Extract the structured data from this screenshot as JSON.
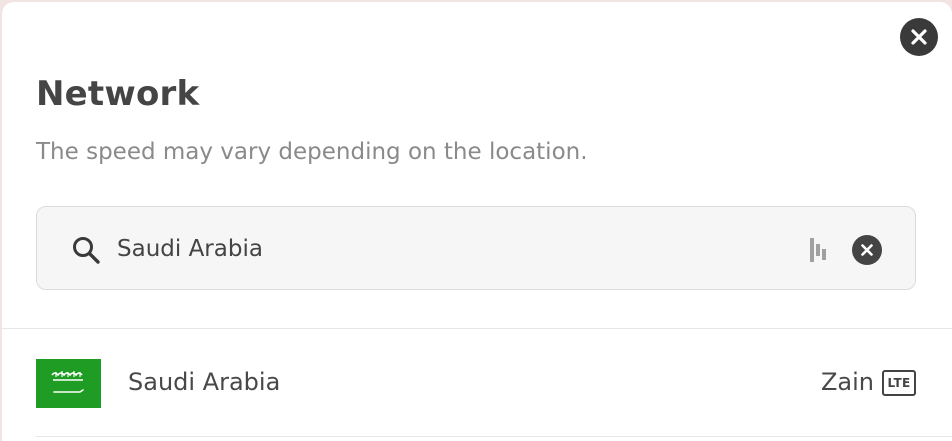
{
  "dialog": {
    "title": "Network",
    "subtitle": "The speed may vary depending on the location.",
    "close_icon": "close-icon"
  },
  "search": {
    "value": "Saudi Arabia",
    "placeholder": "",
    "search_icon": "search-icon",
    "extension_icon": "password-manager-icon",
    "clear_icon": "clear-icon"
  },
  "results": [
    {
      "country": "Saudi Arabia",
      "flag_icon": "saudi-arabia-flag-icon",
      "operator": "Zain",
      "network_type": "LTE"
    }
  ],
  "colors": {
    "modal_background": "#ffffff",
    "title_text": "#454545",
    "subtitle_text": "#8a8a8a",
    "search_background": "#f6f6f6",
    "icon_dark": "#3a3a3a",
    "flag_green": "#1e9c24"
  }
}
